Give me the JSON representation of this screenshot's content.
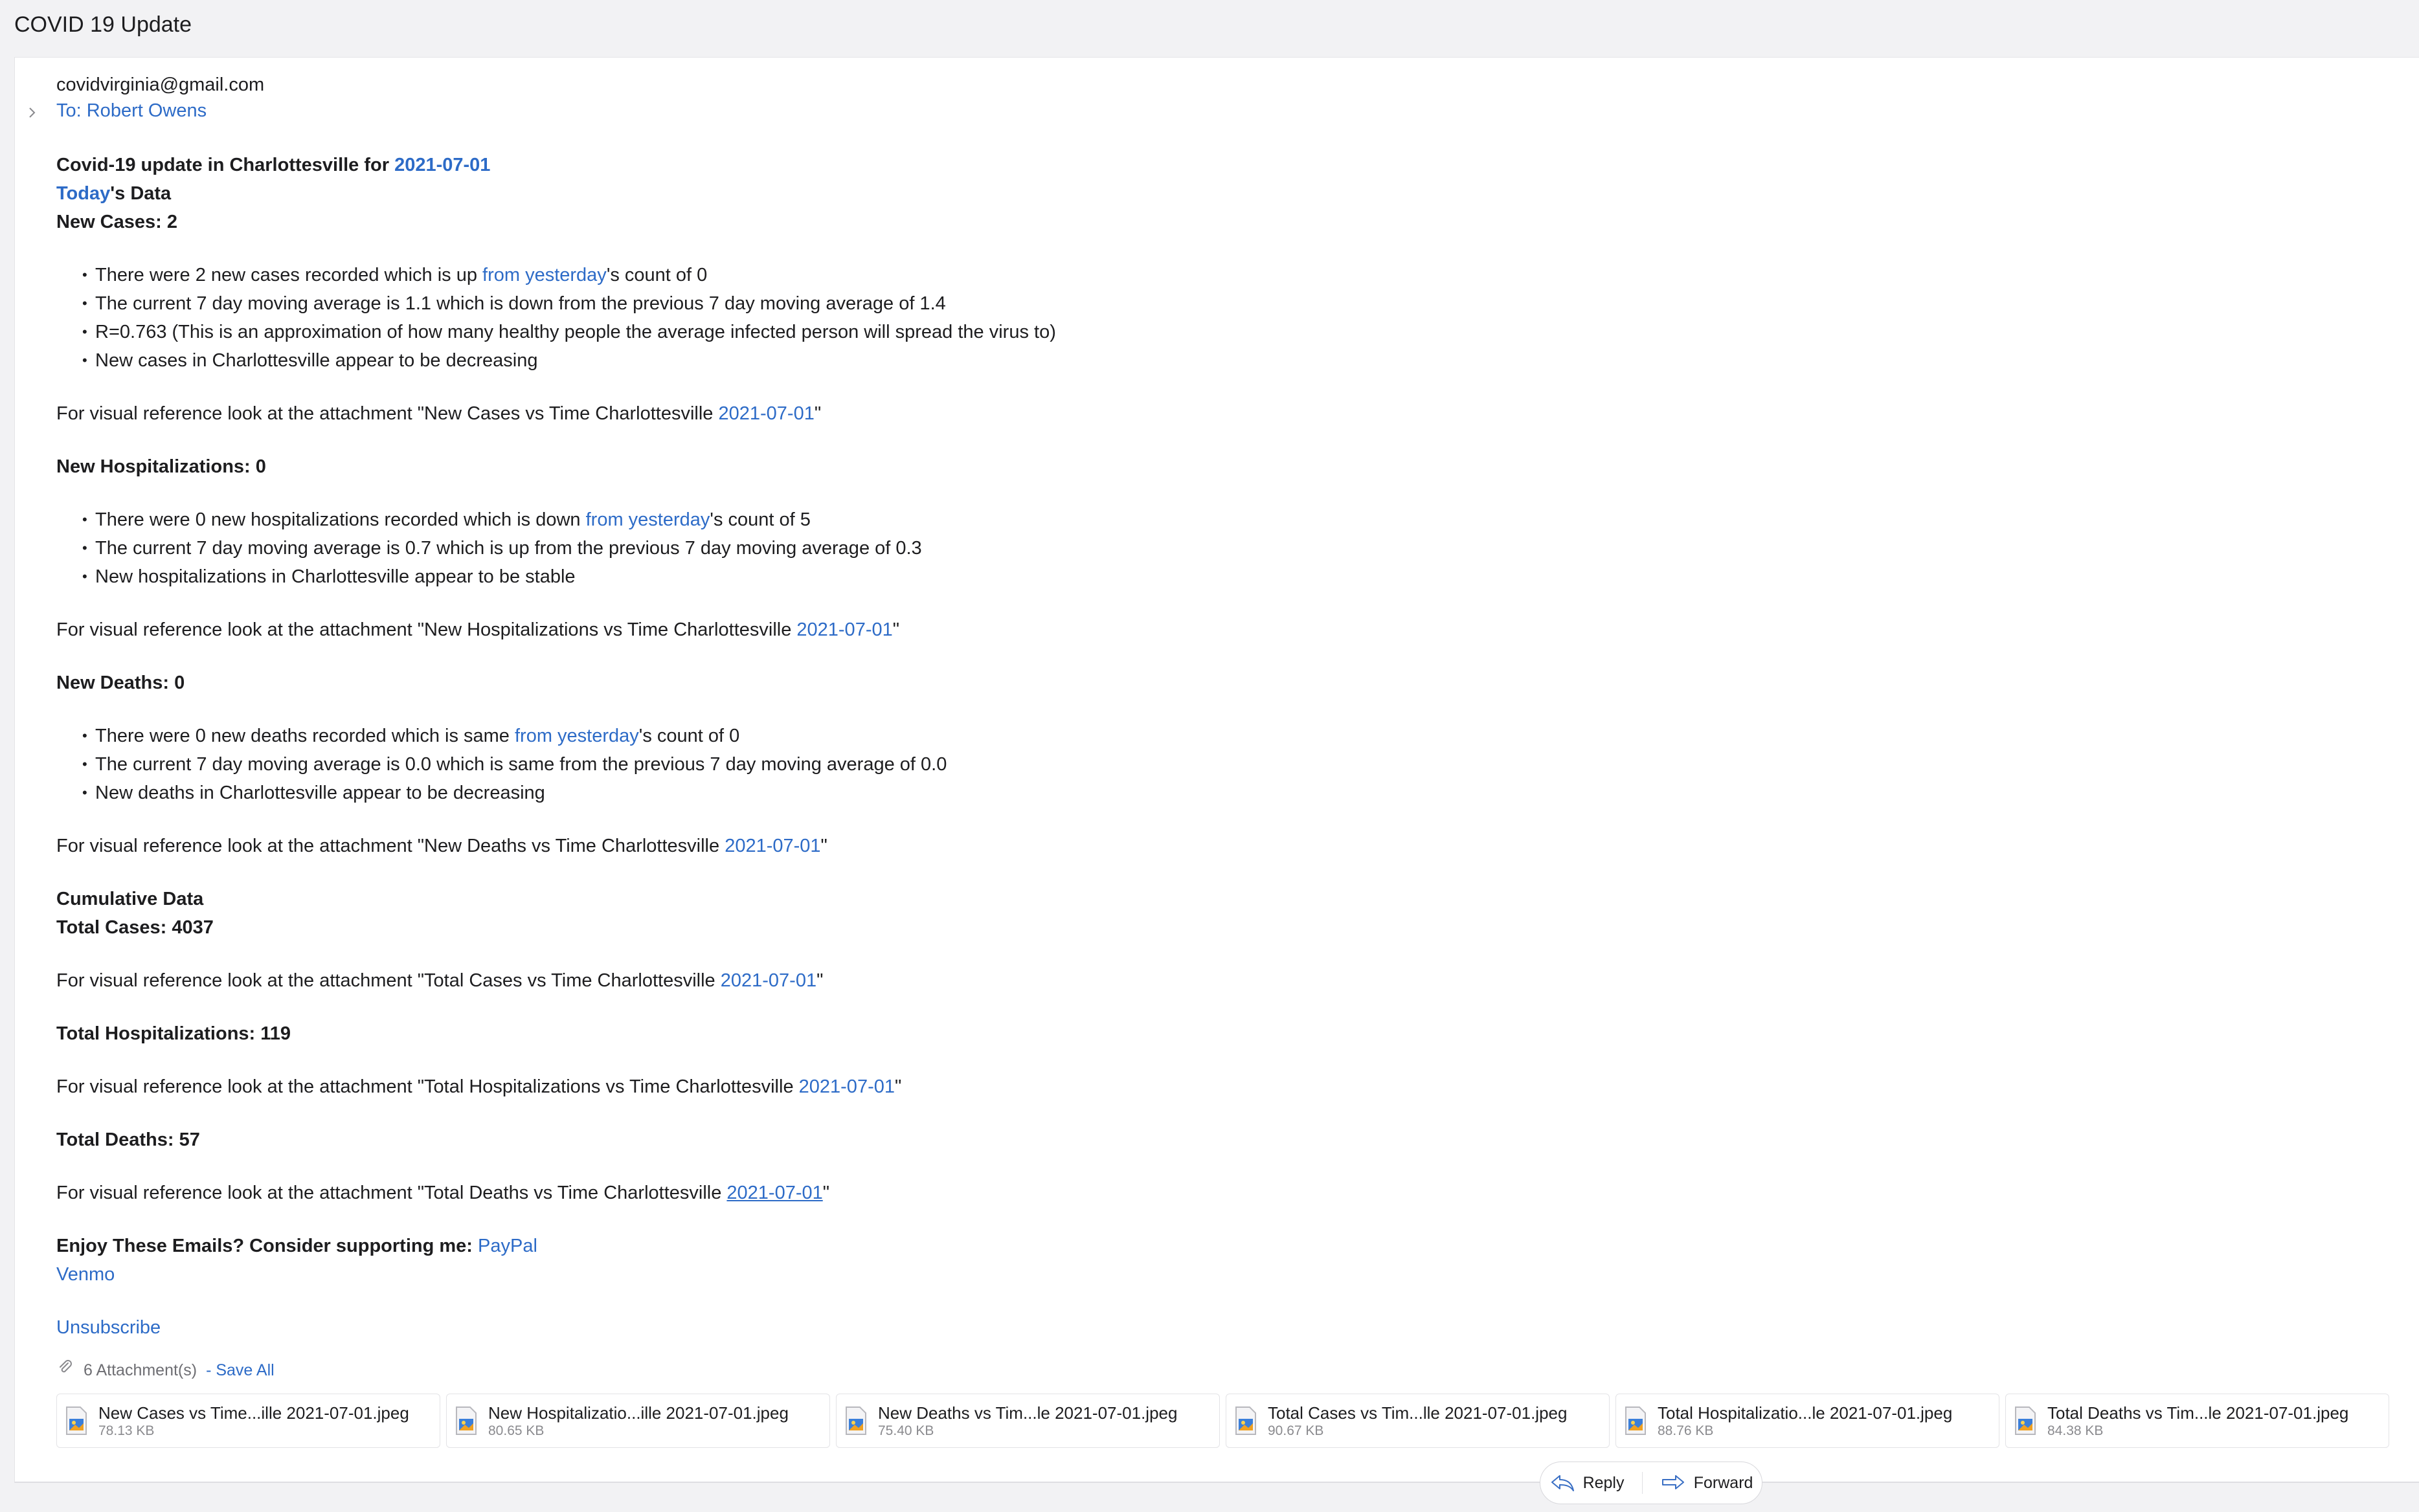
{
  "subject": "COVID 19 Update",
  "sender": "covidvirginia@gmail.com",
  "to": "To: Robert Owens",
  "body": {
    "headline_prefix": "Covid-19 update in Charlottesville for ",
    "date": "2021-07-01",
    "today_link": "Today",
    "today_suffix": "'s Data",
    "new_cases": {
      "heading": "New Cases: 2",
      "b1_pre": "There were 2 new cases recorded which is up ",
      "b1_link": "from yesterday",
      "b1_post": "'s count of 0",
      "b2": "The current 7 day moving average is 1.1 which is down from the previous 7 day moving average of 1.4",
      "b3": "R=0.763 (This is an approximation of how many healthy people the average infected person will spread the virus to)",
      "b4": "New cases in Charlottesville appear to be decreasing",
      "ref_pre": "For visual reference look at the attachment \"New Cases vs Time Charlottesville "
    },
    "new_hosp": {
      "heading": "New Hospitalizations: 0",
      "b1_pre": "There were 0 new hospitalizations recorded which is down ",
      "b1_link": "from yesterday",
      "b1_post": "'s count of 5",
      "b2": "The current 7 day moving average is 0.7 which is up from the previous 7 day moving average of 0.3",
      "b3": "New hospitalizations in Charlottesville appear to be stable",
      "ref_pre": "For visual reference look at the attachment \"New Hospitalizations vs Time Charlottesville "
    },
    "new_deaths": {
      "heading": "New Deaths: 0",
      "b1_pre": "There were 0 new deaths recorded which is same ",
      "b1_link": "from yesterday",
      "b1_post": "'s count of 0",
      "b2": "The current 7 day moving average is 0.0 which is same from the previous 7 day moving average of 0.0",
      "b3": "New deaths in Charlottesville appear to be decreasing",
      "ref_pre": "For visual reference look at the attachment \"New Deaths vs Time Charlottesville "
    },
    "cumulative_heading": "Cumulative Data",
    "total_cases": {
      "heading": "Total Cases: 4037",
      "ref_pre": "For visual reference look at the attachment \"Total Cases vs Time Charlottesville "
    },
    "total_hosp": {
      "heading": "Total Hospitalizations: 119",
      "ref_pre": "For visual reference look at the attachment \"Total Hospitalizations vs Time Charlottesville "
    },
    "total_deaths": {
      "heading": "Total Deaths: 57",
      "ref_pre": "For visual reference look at the attachment \"Total Deaths vs Time Charlottesville "
    },
    "quote_close": "\"",
    "support_text": "Enjoy These Emails? Consider supporting me: ",
    "paypal": "PayPal",
    "venmo": "Venmo",
    "unsubscribe": "Unsubscribe"
  },
  "attachments": {
    "count_label": "6 Attachment(s)",
    "save_all": "- Save All",
    "items": [
      {
        "name": "New Cases vs Time...ille 2021-07-01.jpeg",
        "size": "78.13 KB"
      },
      {
        "name": "New Hospitalizatio...ille  2021-07-01.jpeg",
        "size": "80.65 KB"
      },
      {
        "name": "New Deaths vs Tim...le  2021-07-01.jpeg",
        "size": "75.40 KB"
      },
      {
        "name": "Total Cases vs Tim...lle  2021-07-01.jpeg",
        "size": "90.67 KB"
      },
      {
        "name": "Total Hospitalizatio...le  2021-07-01.jpeg",
        "size": "88.76 KB"
      },
      {
        "name": "Total Deaths vs Tim...le  2021-07-01.jpeg",
        "size": "84.38 KB"
      }
    ]
  },
  "actions": {
    "reply": "Reply",
    "forward": "Forward"
  },
  "colors": {
    "link": "#2d6bc7",
    "background": "#f2f2f4",
    "card": "#ffffff"
  },
  "icons": [
    "chevron-right-icon",
    "paperclip-icon",
    "jpeg-file-icon",
    "reply-icon",
    "forward-icon"
  ]
}
